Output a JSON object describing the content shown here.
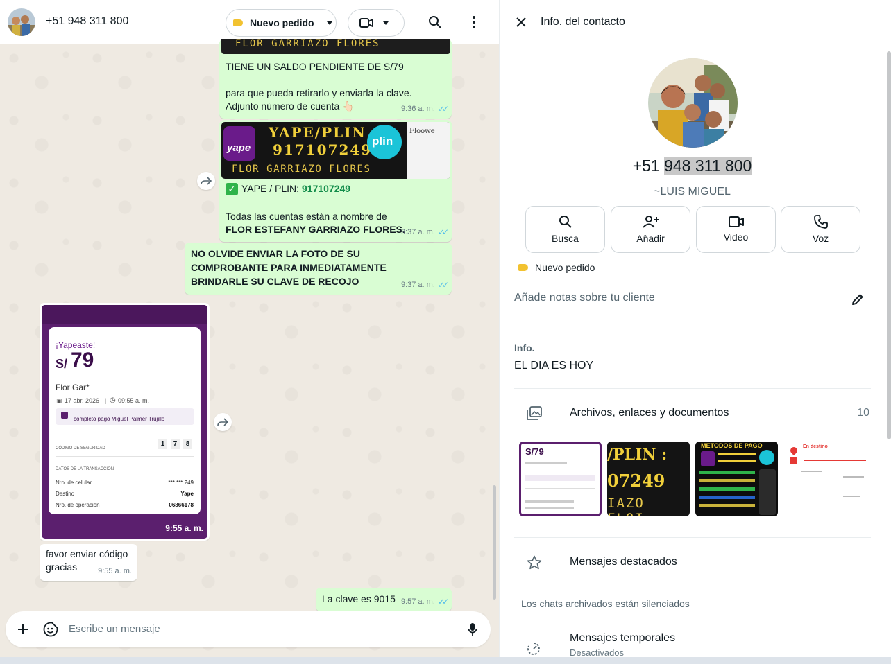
{
  "chat": {
    "contact_name": "+51 948 311 800",
    "order_pill_label": "Nuevo pedido",
    "messages": {
      "balance_line": "TIENE UN SALDO PENDIENTE DE S/79",
      "withdraw_line1": "para que pueda retirarlo y enviarla la clave.",
      "withdraw_line2": "Adjunto número de cuenta 👆🏻",
      "time_936": "9:36 a. m.",
      "banner_title": "YAPE/PLIN :",
      "banner_number": "917107249",
      "banner_name": "FLOR GARRIAZO FLORES",
      "banner_side": "Floowe",
      "top_banner_name": "FLOR GARRIAZO FLORES",
      "yape_line_prefix": "YAPE / PLIN: ",
      "yape_line_number": "917107249",
      "accounts_line1": "Todas las cuentas están a nombre de",
      "accounts_line2": "FLOR ESTEFANY GARRIAZO FLORES.",
      "time_937a": "9:37 a. m.",
      "reminder": "NO OLVIDE ENVIAR LA FOTO DE SU COMPROBANTE PARA INMEDIATAMENTE BRINDARLE SU CLAVE DE RECOJO",
      "time_937b": "9:37 a. m.",
      "receipt": {
        "heading": "¡Yapeaste!",
        "currency": "S/",
        "amount": "79",
        "name": "Flor Gar*",
        "date": "17 abr. 2026",
        "time": "09:55 a. m.",
        "note": "completo pago Miguel Palmer Trujillo",
        "security_label": "CÓDIGO DE SEGURIDAD",
        "security_digits": [
          "1",
          "7",
          "8"
        ],
        "details_label": "DATOS DE LA TRANSACCIÓN",
        "rows": [
          {
            "label": "Nro. de celular",
            "value": "*** *** 249"
          },
          {
            "label": "Destino",
            "value": "Yape"
          },
          {
            "label": "Nro. de operación",
            "value": "06866178"
          }
        ],
        "stamp": "9:55 a. m."
      },
      "request_line1": "favor enviar código",
      "request_line2": "gracias",
      "time_955": "9:55 a. m.",
      "code_msg": "La clave es 9015",
      "time_957": "9:57 a. m."
    },
    "composer_placeholder": "Escribe un mensaje"
  },
  "info": {
    "title": "Info. del contacto",
    "number_prefix": "+51 ",
    "number_highlight": "948 311 800",
    "alias": "~LUIS MIGUEL",
    "actions": [
      {
        "label": "Busca",
        "icon": "search-icon"
      },
      {
        "label": "Añadir",
        "icon": "add-person-icon"
      },
      {
        "label": "Video",
        "icon": "video-icon"
      },
      {
        "label": "Voz",
        "icon": "phone-icon"
      }
    ],
    "tag_label": "Nuevo pedido",
    "notes_placeholder": "Añade notas sobre tu cliente",
    "info_label": "Info.",
    "info_text": "EL DIA ES HOY",
    "files_label": "Archivos, enlaces y documentos",
    "files_count": "10",
    "thumbs": {
      "t1_amount": "S/79",
      "t2_line1": "/PLIN :",
      "t2_line2": "07249",
      "t2_line3": "IAZO FLOI",
      "t3_title": "METODOS DE PAGO",
      "t4_title": "En destino"
    },
    "starred_label": "Mensajes destacados",
    "archived_note": "Los chats archivados están silenciados",
    "temp_label": "Mensajes temporales",
    "temp_sub": "Desactivados"
  },
  "colors": {
    "outgoing_bubble": "#d9fdd3",
    "incoming_bubble": "#ffffff",
    "wallpaper": "#efeae2",
    "yape_purple": "#5b1f6e",
    "tag_yellow": "#f2c230",
    "read_ticks": "#53bdeb",
    "link_green": "#128c4a"
  }
}
